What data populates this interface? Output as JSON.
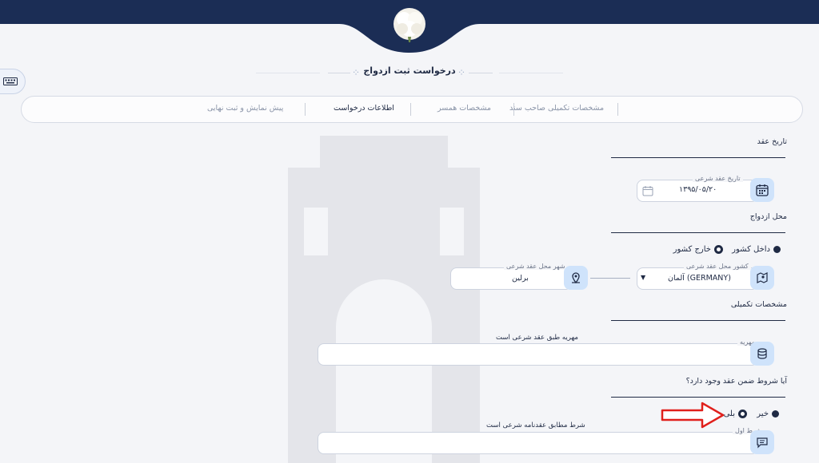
{
  "page": {
    "title": "درخواست ثبت ازدواج"
  },
  "tabs": [
    {
      "label": "مشخصات تکمیلی صاحب سند",
      "active": false
    },
    {
      "label": "مشخصات همسر",
      "active": false
    },
    {
      "label": "اطلاعات درخواست",
      "active": true
    },
    {
      "label": "پیش نمایش و ثبت نهایی",
      "active": false
    }
  ],
  "contract_date": {
    "section_title": "تاریخ عقد",
    "label": "تاریخ عقد شرعی",
    "value": "۱۳۹۵/۰۵/۲۰"
  },
  "marriage_place": {
    "section_title": "محل ازدواج",
    "options": [
      {
        "label": "داخل کشور",
        "selected": true
      },
      {
        "label": "خارج کشور",
        "selected": false
      }
    ],
    "country_label": "کشور محل عقد شرعی",
    "country_value": "آلمان (GERMANY)",
    "city_label": "شهر محل عقد شرعی",
    "city_value": "برلین"
  },
  "extra_details": {
    "section_title": "مشخصات تکمیلی",
    "mahr_label": "مهریه",
    "mahr_value": "مهریه طبق عقد شرعی است"
  },
  "conditions": {
    "section_title": "آیا شروط ضمن عقد وجود دارد؟",
    "options": [
      {
        "label": "خیر",
        "selected": true
      },
      {
        "label": "بلی",
        "selected": false
      }
    ],
    "first_label": "شرط اول",
    "first_value": "شرط مطابق عقدنامه شرعی است"
  },
  "colors": {
    "header": "#1b2d55",
    "accent": "#1f2a44",
    "icon_bg": "#cfe3fb",
    "arrow": "#e0201c"
  }
}
